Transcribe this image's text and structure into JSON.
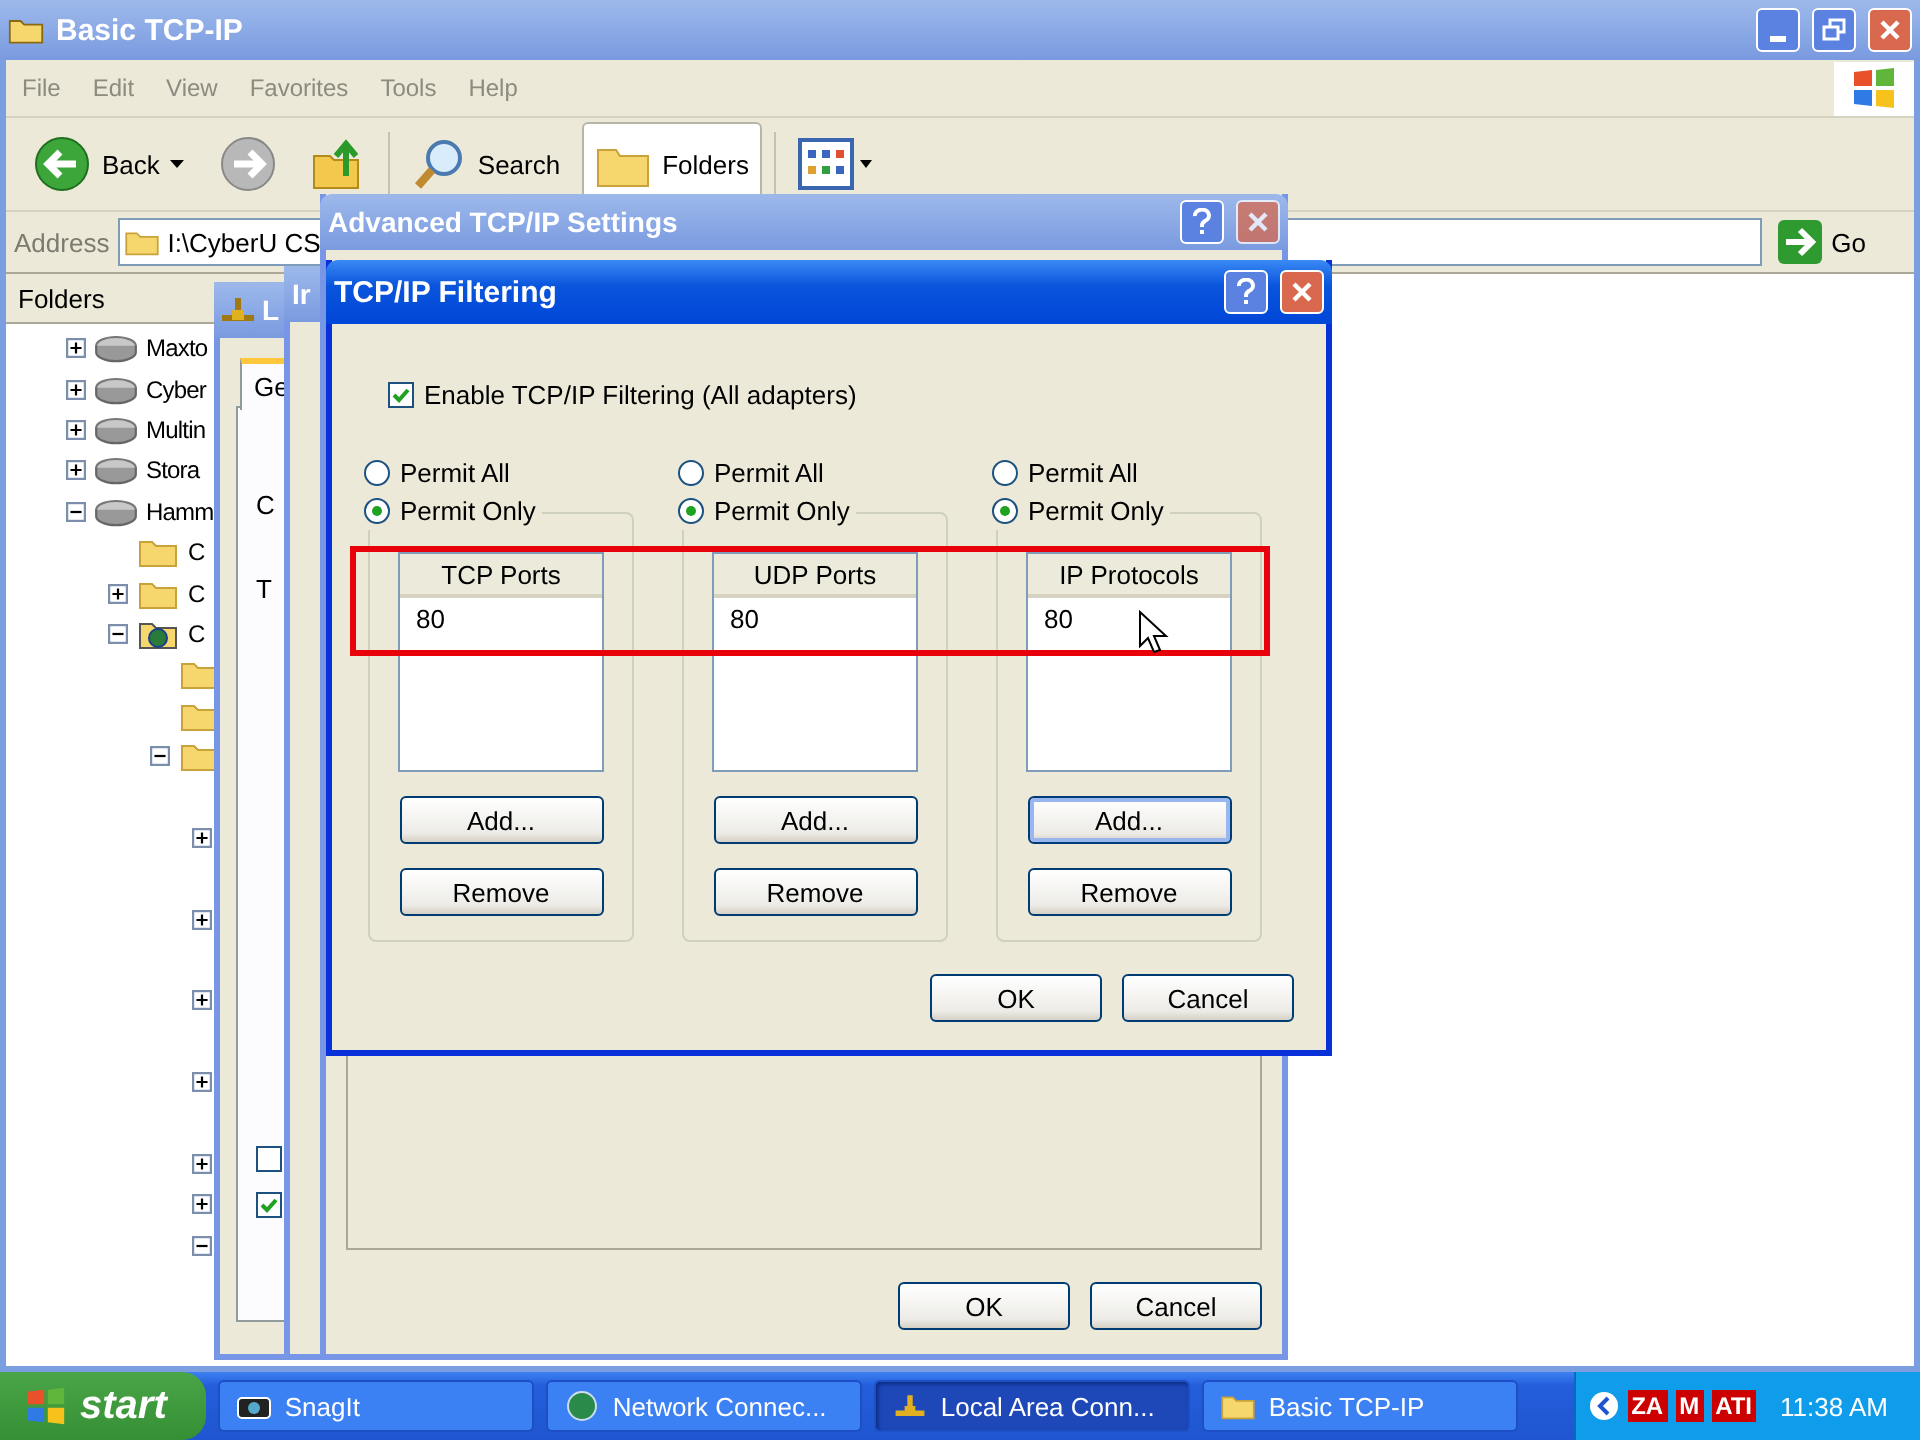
{
  "explorer": {
    "title": "Basic TCP-IP",
    "menu": [
      "File",
      "Edit",
      "View",
      "Favorites",
      "Tools",
      "Help"
    ],
    "toolbar": [
      {
        "kind": "back",
        "label": "Back"
      },
      {
        "kind": "forward"
      },
      {
        "kind": "up"
      },
      {
        "kind": "search",
        "label": "Search"
      },
      {
        "kind": "folders",
        "label": "Folders",
        "selected": true
      },
      {
        "kind": "views"
      }
    ],
    "address": {
      "label": "Address",
      "value": "I:\\CyberU CS",
      "go": "Go"
    },
    "folders_pane": {
      "title": "Folders",
      "tree": [
        {
          "kind": "drive",
          "label": "Maxto",
          "expanded": false
        },
        {
          "kind": "drive",
          "label": "Cyber",
          "expanded": false
        },
        {
          "kind": "drive",
          "label": "Multin",
          "expanded": false
        },
        {
          "kind": "drive",
          "label": "Stora",
          "expanded": false
        },
        {
          "kind": "drive",
          "label": "Hamm",
          "expanded": true,
          "children": [
            {
              "kind": "folder",
              "label": "C"
            },
            {
              "kind": "folder",
              "label": "C",
              "expanded": false
            },
            {
              "kind": "web-folder",
              "label": "C",
              "expanded": true,
              "children": [
                {
                  "kind": "folder"
                },
                {
                  "kind": "folder"
                },
                {
                  "kind": "folder",
                  "expanded": true,
                  "children": [
                    {
                      "expanded": false
                    },
                    {
                      "expanded": false
                    },
                    {
                      "expanded": false
                    },
                    {
                      "expanded": false
                    },
                    {
                      "expanded": false
                    },
                    {
                      "expanded": false
                    },
                    {
                      "expanded": true
                    }
                  ]
                }
              ]
            }
          ]
        }
      ]
    }
  },
  "background_dialogs": [
    {
      "title": "L",
      "tab": "Ge",
      "labels": [
        "C",
        "T"
      ],
      "checkboxes": [
        {
          "checked": false
        },
        {
          "checked": true
        }
      ]
    },
    {
      "title": "Ir"
    }
  ],
  "advanced": {
    "title": "Advanced TCP/IP Settings",
    "buttons": [
      "OK",
      "Cancel"
    ]
  },
  "filtering": {
    "title": "TCP/IP Filtering",
    "enable": {
      "label": "Enable TCP/IP Filtering (All adapters)",
      "checked": true
    },
    "groups": [
      {
        "options": [
          {
            "label": "Permit All",
            "selected": false
          },
          {
            "label": "Permit Only",
            "selected": true
          }
        ],
        "list_header": "TCP Ports",
        "items": [
          "80"
        ],
        "buttons": [
          {
            "label": "Add...",
            "focused": false
          },
          {
            "label": "Remove",
            "focused": false
          }
        ]
      },
      {
        "options": [
          {
            "label": "Permit All",
            "selected": false
          },
          {
            "label": "Permit Only",
            "selected": true
          }
        ],
        "list_header": "UDP Ports",
        "items": [
          "80"
        ],
        "buttons": [
          {
            "label": "Add...",
            "focused": false
          },
          {
            "label": "Remove",
            "focused": false
          }
        ]
      },
      {
        "options": [
          {
            "label": "Permit All",
            "selected": false
          },
          {
            "label": "Permit Only",
            "selected": true
          }
        ],
        "list_header": "IP Protocols",
        "items": [
          "80"
        ],
        "buttons": [
          {
            "label": "Add...",
            "focused": true
          },
          {
            "label": "Remove",
            "focused": false
          }
        ]
      }
    ],
    "buttons": [
      "OK",
      "Cancel"
    ]
  },
  "taskbar": {
    "start": "start",
    "tasks": [
      {
        "kind": "camera",
        "label": "SnagIt",
        "selected": false
      },
      {
        "kind": "network",
        "label": "Network Connec...",
        "selected": false
      },
      {
        "kind": "lan",
        "label": "Local Area Conn...",
        "selected": true
      },
      {
        "kind": "folder",
        "label": "Basic TCP-IP",
        "selected": false
      }
    ],
    "tray": [
      "ZA",
      "M",
      "ATI"
    ],
    "clock": "11:38 AM"
  }
}
